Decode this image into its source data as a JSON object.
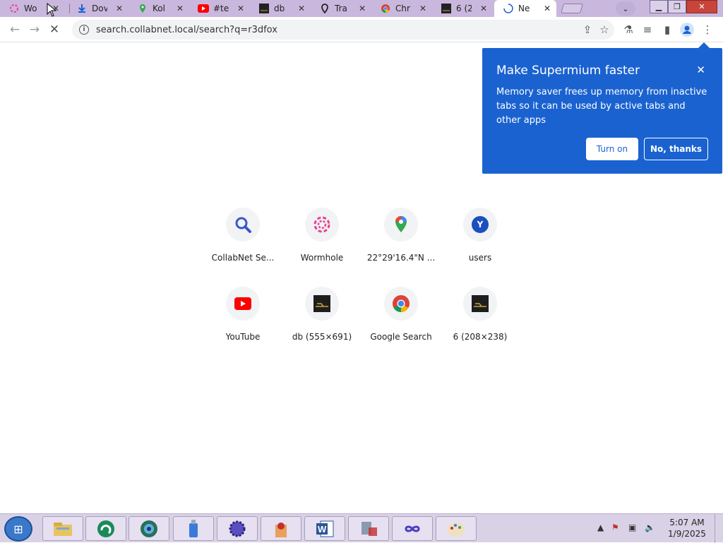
{
  "browser": {
    "tabs": [
      {
        "title": "Wo",
        "icon": "wormhole-icon",
        "icon_color": "#e84393"
      },
      {
        "title": "Dov",
        "icon": "download-icon",
        "icon_color": "#1a62d0"
      },
      {
        "title": "Kol",
        "icon": "maps-pin-icon",
        "icon_color": "#34a853"
      },
      {
        "title": "#te",
        "icon": "youtube-icon",
        "icon_color": "#ff0000"
      },
      {
        "title": "db",
        "icon": "image-thumb-icon",
        "icon_color": "#333333"
      },
      {
        "title": "Tra",
        "icon": "location-pin-icon",
        "icon_color": "#222222"
      },
      {
        "title": "Chr",
        "icon": "chrome-icon",
        "icon_color": "#4285f4"
      },
      {
        "title": "6 (2",
        "icon": "image-thumb-icon",
        "icon_color": "#333333"
      },
      {
        "title": "Ne",
        "icon": "loading-icon",
        "icon_color": "#1a62d0"
      }
    ],
    "tab_close_glyph": "✕",
    "url": "search.collabnet.local/search?q=r3dfox"
  },
  "popup": {
    "title": "Make Supermium faster",
    "body": "Memory saver frees up memory from inactive tabs so it can be used by active tabs and other apps",
    "turn_on": "Turn on",
    "no_thanks": "No, thanks",
    "close_glyph": "✕"
  },
  "shortcuts": [
    {
      "label": "CollabNet Se...",
      "icon": "search-icon"
    },
    {
      "label": "Wormhole",
      "icon": "wormhole-icon"
    },
    {
      "label": "22°29'16.4\"N ...",
      "icon": "maps-pin-icon"
    },
    {
      "label": "users",
      "icon": "letter-y-icon",
      "letter": "Y"
    },
    {
      "label": "YouTube",
      "icon": "youtube-icon"
    },
    {
      "label": "db (555×691)",
      "icon": "image-thumb-icon"
    },
    {
      "label": "Google Search",
      "icon": "chrome-icon"
    },
    {
      "label": "6 (208×238)",
      "icon": "image-thumb-icon"
    }
  ],
  "taskbar": {
    "time": "5:07 AM",
    "date": "1/9/2025"
  }
}
